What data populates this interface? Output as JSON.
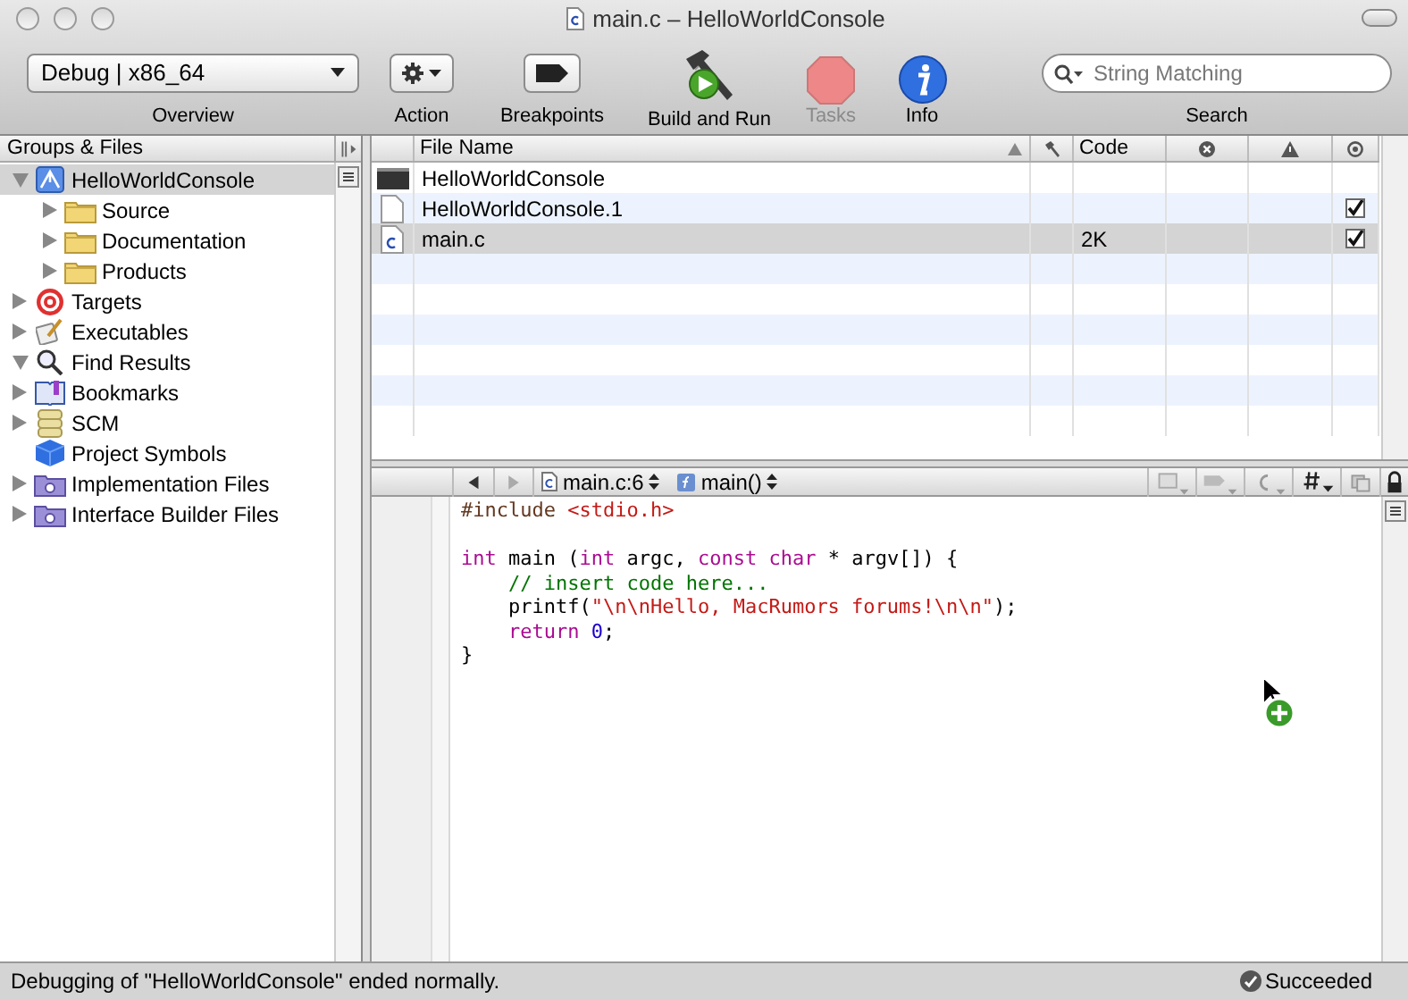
{
  "window": {
    "title": "main.c – HelloWorldConsole"
  },
  "toolbar": {
    "overview": {
      "value": "Debug | x86_64",
      "label": "Overview"
    },
    "items": [
      {
        "kind": "action",
        "label": "Action",
        "disabled": false
      },
      {
        "kind": "breakpoints",
        "label": "Breakpoints",
        "disabled": false
      },
      {
        "kind": "build",
        "label": "Build and Run",
        "disabled": false
      },
      {
        "kind": "tasks",
        "label": "Tasks",
        "disabled": true
      },
      {
        "kind": "info",
        "label": "Info",
        "disabled": false
      }
    ],
    "search": {
      "placeholder": "String Matching",
      "label": "Search"
    }
  },
  "sidebar": {
    "title": "Groups & Files",
    "items": [
      {
        "label": "HelloWorldConsole",
        "kind": "project",
        "expandable": true,
        "expanded": true,
        "selected": true,
        "children": [
          {
            "label": "Source",
            "kind": "folder",
            "expandable": true,
            "expanded": false,
            "selected": false
          },
          {
            "label": "Documentation",
            "kind": "folder",
            "expandable": true,
            "expanded": false,
            "selected": false
          },
          {
            "label": "Products",
            "kind": "folder",
            "expandable": true,
            "expanded": false,
            "selected": false
          }
        ]
      },
      {
        "label": "Targets",
        "kind": "target",
        "expandable": true,
        "expanded": false,
        "selected": false
      },
      {
        "label": "Executables",
        "kind": "exec",
        "expandable": true,
        "expanded": false,
        "selected": false
      },
      {
        "label": "Find Results",
        "kind": "search",
        "expandable": true,
        "expanded": true,
        "selected": false
      },
      {
        "label": "Bookmarks",
        "kind": "book",
        "expandable": true,
        "expanded": false,
        "selected": false
      },
      {
        "label": "SCM",
        "kind": "scm",
        "expandable": true,
        "expanded": false,
        "selected": false
      },
      {
        "label": "Project Symbols",
        "kind": "cube",
        "expandable": false,
        "selected": false
      },
      {
        "label": "Implementation Files",
        "kind": "smart",
        "expandable": true,
        "expanded": false,
        "selected": false
      },
      {
        "label": "Interface Builder Files",
        "kind": "smart",
        "expandable": true,
        "expanded": false,
        "selected": false
      }
    ]
  },
  "file_table": {
    "columns": [
      "File Name",
      "Code"
    ],
    "rows": [
      {
        "kind": "terminal",
        "name": "HelloWorldConsole",
        "has_checkbox": false,
        "selected": false
      },
      {
        "kind": "doc",
        "name": "HelloWorldConsole.1",
        "has_checkbox": true,
        "checked": true,
        "selected": false
      },
      {
        "kind": "cfile",
        "name": "main.c",
        "code": "2K",
        "has_checkbox": true,
        "checked": true,
        "selected": true
      }
    ]
  },
  "editor": {
    "file_popup": "main.c:6",
    "function_popup": "main()",
    "lines": [
      {
        "kind": "code",
        "tokens": [
          {
            "kind": "preproc",
            "text": "#include "
          },
          {
            "kind": "string",
            "text": "<stdio.h>"
          }
        ]
      },
      {
        "kind": "blank"
      },
      {
        "kind": "code",
        "tokens": [
          {
            "kind": "keyword",
            "text": "int"
          },
          {
            "kind": "plain",
            "text": " main ("
          },
          {
            "kind": "keyword",
            "text": "int"
          },
          {
            "kind": "plain",
            "text": " argc, "
          },
          {
            "kind": "keyword",
            "text": "const char"
          },
          {
            "kind": "plain",
            "text": " * argv[]) {"
          }
        ]
      },
      {
        "kind": "code",
        "tokens": [
          {
            "kind": "comment",
            "text": "    // insert code here..."
          }
        ]
      },
      {
        "kind": "code",
        "tokens": [
          {
            "kind": "plain",
            "text": "    printf("
          },
          {
            "kind": "string",
            "text": "\"\\n\\nHello, MacRumors forums!\\n\\n\""
          },
          {
            "kind": "plain",
            "text": ");"
          }
        ]
      },
      {
        "kind": "code",
        "tokens": [
          {
            "kind": "keyword",
            "text": "    return"
          },
          {
            "kind": "number",
            "text": " 0"
          },
          {
            "kind": "plain",
            "text": ";"
          }
        ]
      },
      {
        "kind": "code",
        "tokens": [
          {
            "kind": "plain",
            "text": "}"
          }
        ]
      }
    ]
  },
  "status_bar": {
    "message": "Debugging of \"HelloWorldConsole\" ended normally.",
    "result": "Succeeded"
  }
}
